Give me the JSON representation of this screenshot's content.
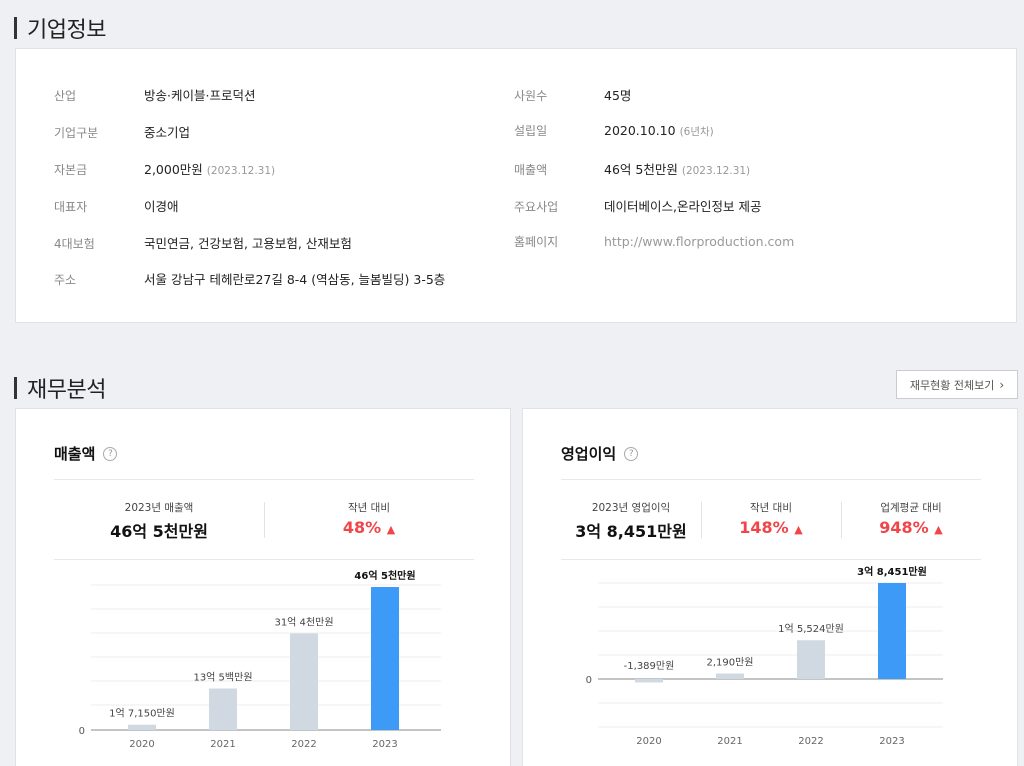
{
  "company": {
    "title": "기업정보",
    "left": [
      {
        "label": "산업",
        "value": "방송·케이블·프로덕션",
        "sub": ""
      },
      {
        "label": "기업구분",
        "value": "중소기업",
        "sub": ""
      },
      {
        "label": "자본금",
        "value": "2,000만원",
        "sub": "(2023.12.31)"
      },
      {
        "label": "대표자",
        "value": "이경애",
        "sub": ""
      },
      {
        "label": "4대보험",
        "value": "국민연금, 건강보험, 고용보험, 산재보험",
        "sub": ""
      },
      {
        "label": "주소",
        "value": "서울 강남구 테헤란로27길 8-4 (역삼동, 늘봄빌딩) 3-5층",
        "sub": ""
      }
    ],
    "right": [
      {
        "label": "사원수",
        "value": "45명",
        "sub": ""
      },
      {
        "label": "설립일",
        "value": "2020.10.10",
        "sub": "(6년차)"
      },
      {
        "label": "매출액",
        "value": "46억 5천만원",
        "sub": "(2023.12.31)"
      },
      {
        "label": "주요사업",
        "value": "데이터베이스,온라인정보 제공",
        "sub": ""
      },
      {
        "label": "홈페이지",
        "value": "http://www.florproduction.com",
        "sub": ""
      }
    ]
  },
  "finance": {
    "title": "재무분석",
    "more_button": "재무현황 전체보기",
    "more_icon": "chevron-right-icon",
    "help_icon": "question-icon",
    "up_icon": "triangle-up-icon",
    "accent_red": "#f0464a",
    "accent_blue": "#3d9bf7",
    "bar_gray": "#d0d9e1"
  },
  "revenue": {
    "title": "매출액",
    "stats": [
      {
        "label": "2023년 매출액",
        "value": "46억 5천만원"
      },
      {
        "label": "작년 대비",
        "value": "48%"
      }
    ]
  },
  "profit": {
    "title": "영업이익",
    "stats": [
      {
        "label": "2023년 영업이익",
        "value": "3억 8,451만원"
      },
      {
        "label": "작년 대비",
        "value": "148%"
      },
      {
        "label": "업계평균 대비",
        "value": "948%"
      }
    ]
  },
  "chart_data": [
    {
      "type": "bar",
      "categories": [
        "2020",
        "2021",
        "2022",
        "2023"
      ],
      "values": [
        17150,
        135000,
        314000,
        465000
      ],
      "data_labels": [
        "1억 7,150만원",
        "13억 5백만원",
        "31억 4천만원",
        "46억 5천만원"
      ],
      "ytick": "0",
      "highlight_index": 3
    },
    {
      "type": "bar",
      "categories": [
        "2020",
        "2021",
        "2022",
        "2023"
      ],
      "values": [
        -1389,
        2190,
        15524,
        38451
      ],
      "data_labels": [
        "-1,389만원",
        "2,190만원",
        "1억 5,524만원",
        "3억 8,451만원"
      ],
      "ytick": "0",
      "highlight_index": 3
    }
  ]
}
